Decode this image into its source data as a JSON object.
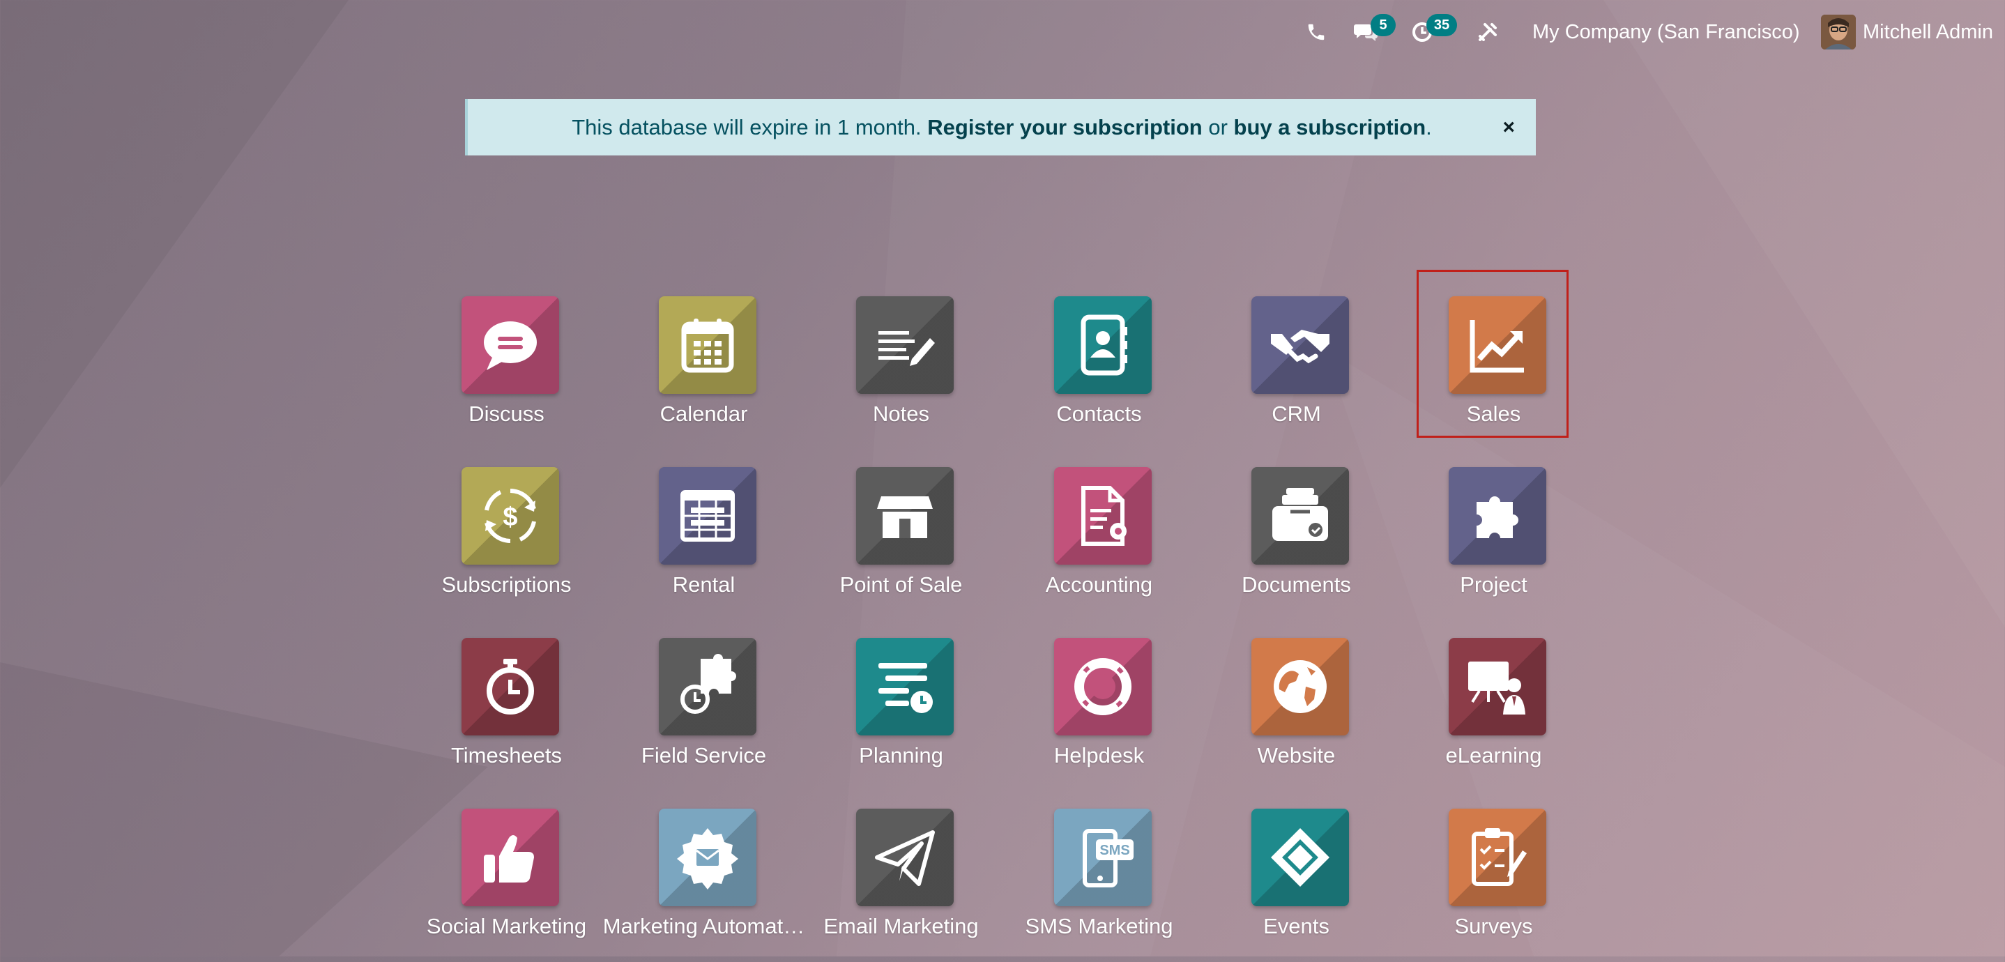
{
  "topbar": {
    "messages_count": "5",
    "activities_count": "35",
    "company": "My Company (San Francisco)",
    "user": "Mitchell Admin"
  },
  "banner": {
    "text_before": "This database will expire in 1 month.",
    "register_link": "Register your subscription",
    "text_middle": "or",
    "buy_link": "buy a subscription",
    "text_end": ".",
    "close_symbol": "×"
  },
  "apps": [
    {
      "label": "Discuss",
      "color": "#c2527b",
      "icon": "chat-bubble-icon"
    },
    {
      "label": "Calendar",
      "color": "#b3a956",
      "icon": "calendar-icon"
    },
    {
      "label": "Notes",
      "color": "#5c5c5c",
      "icon": "notes-icon"
    },
    {
      "label": "Contacts",
      "color": "#1e8a8c",
      "icon": "address-book-icon"
    },
    {
      "label": "CRM",
      "color": "#63628b",
      "icon": "handshake-icon"
    },
    {
      "label": "Sales",
      "color": "#d27a4a",
      "icon": "sales-chart-icon"
    },
    {
      "label": "Subscriptions",
      "color": "#b3a956",
      "icon": "recurring-dollar-icon"
    },
    {
      "label": "Rental",
      "color": "#63628b",
      "icon": "rental-table-icon"
    },
    {
      "label": "Point of Sale",
      "color": "#5c5c5c",
      "icon": "shop-icon"
    },
    {
      "label": "Accounting",
      "color": "#c2527b",
      "icon": "document-gear-icon"
    },
    {
      "label": "Documents",
      "color": "#5c5c5c",
      "icon": "inbox-tray-icon"
    },
    {
      "label": "Project",
      "color": "#63628b",
      "icon": "puzzle-icon"
    },
    {
      "label": "Timesheets",
      "color": "#8c3c48",
      "icon": "stopwatch-icon"
    },
    {
      "label": "Field Service",
      "color": "#5c5c5c",
      "icon": "puzzle-stopwatch-icon"
    },
    {
      "label": "Planning",
      "color": "#1e8a8c",
      "icon": "planning-icon"
    },
    {
      "label": "Helpdesk",
      "color": "#c2527b",
      "icon": "lifebuoy-icon"
    },
    {
      "label": "Website",
      "color": "#d27a4a",
      "icon": "globe-icon"
    },
    {
      "label": "eLearning",
      "color": "#8c3c48",
      "icon": "presentation-icon"
    },
    {
      "label": "Social Marketing",
      "color": "#c2527b",
      "icon": "thumbs-up-icon"
    },
    {
      "label": "Marketing Automat…",
      "color": "#7ba6c0",
      "icon": "gear-envelope-icon"
    },
    {
      "label": "Email Marketing",
      "color": "#5c5c5c",
      "icon": "paper-plane-icon"
    },
    {
      "label": "SMS Marketing",
      "color": "#7ba6c0",
      "icon": "sms-phone-icon"
    },
    {
      "label": "Events",
      "color": "#1e8a8c",
      "icon": "ticket-icon"
    },
    {
      "label": "Surveys",
      "color": "#d27a4a",
      "icon": "clipboard-check-icon"
    }
  ]
}
